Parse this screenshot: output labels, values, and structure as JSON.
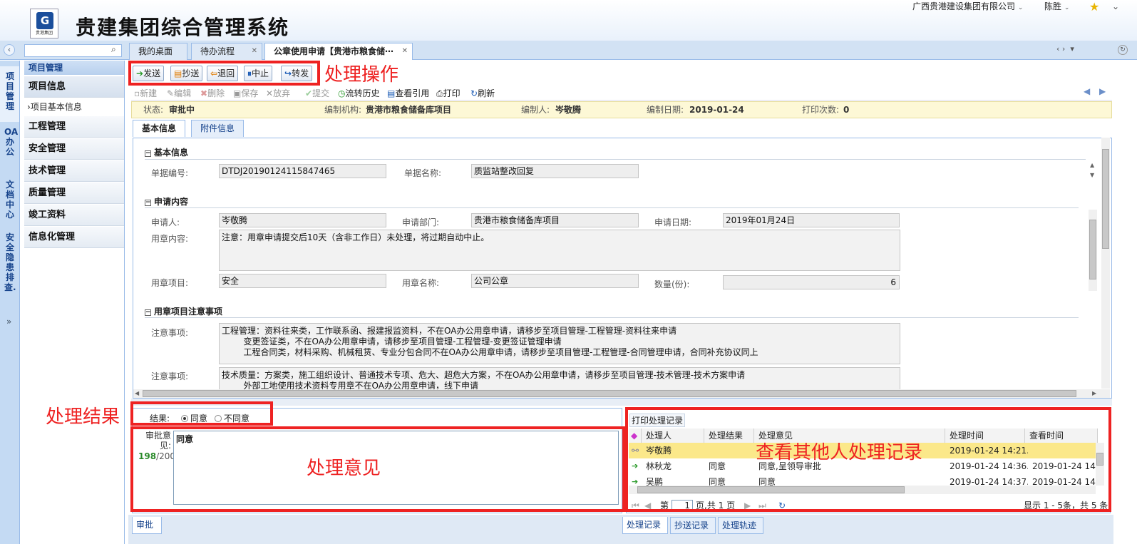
{
  "header": {
    "system_title": "贵建集团综合管理系统",
    "logo_text": "贵港集团",
    "company": "广西贵港建设集团有限公司",
    "user": "陈胜"
  },
  "search": {
    "placeholder": ""
  },
  "tabs": [
    {
      "label": "我的桌面"
    },
    {
      "label": "待办流程"
    },
    {
      "label": "公章使用申请【贵港市粮食储⋯"
    }
  ],
  "vertical_nav": [
    "项目管理",
    "OA办公",
    "文档中心",
    "安全隐患排查..."
  ],
  "sidebar": {
    "header": "项目管理",
    "items": [
      "项目信息",
      "工程管理",
      "安全管理",
      "技术管理",
      "质量管理",
      "竣工资料",
      "信息化管理"
    ],
    "sub_item": "项目基本信息"
  },
  "actions": {
    "send": "发送",
    "cc": "抄送",
    "return": "退回",
    "stop": "中止",
    "forward": "转发"
  },
  "toolbar": {
    "new": "新建",
    "edit": "编辑",
    "delete": "删除",
    "save": "保存",
    "discard": "放弃",
    "submit": "提交",
    "history": "流转历史",
    "view_ref": "查看引用",
    "print": "打印",
    "refresh": "刷新"
  },
  "status": {
    "state_label": "状态:",
    "state_value": "审批中",
    "org_label": "编制机构:",
    "org_value": "贵港市粮食储备库项目",
    "author_label": "编制人:",
    "author_value": "岑敬腾",
    "date_label": "编制日期:",
    "date_value": "2019-01-24",
    "print_label": "打印次数:",
    "print_value": "0"
  },
  "form_tabs": [
    "基本信息",
    "附件信息"
  ],
  "form": {
    "sec_basic": "基本信息",
    "doc_no_label": "单据编号:",
    "doc_no": "DTDJ20190124115847465",
    "doc_name_label": "单据名称:",
    "doc_name": "质监站整改回复",
    "sec_apply": "申请内容",
    "applicant_label": "申请人:",
    "applicant": "岑敬腾",
    "dept_label": "申请部门:",
    "dept": "贵港市粮食储备库项目",
    "apply_date_label": "申请日期:",
    "apply_date": "2019年01月24日",
    "content_label": "用章内容:",
    "content": "注意：用章申请提交后10天（含非工作日）未处理，将过期自动中止。",
    "seal_item_label": "用章项目:",
    "seal_item": "安全",
    "seal_name_label": "用章名称:",
    "seal_name": "公司公章",
    "qty_label": "数量(份):",
    "qty": "6",
    "sec_notes": "用章项目注意事项",
    "note1_label": "注意事项:",
    "note1": "工程管理：资料往来类，工作联系函、报建报监资料，不在OA办公用章申请，请移步至项目管理-工程管理-资料往来申请\n        变更签证类，不在OA办公用章申请，请移步至项目管理-工程管理-变更签证管理申请\n        工程合同类，材料采购、机械租赁、专业分包合同不在OA办公用章申请，请移步至项目管理-工程管理-合同管理申请，合同补充协议同上",
    "note2_label": "注意事项:",
    "note2": "技术质量：方案类，施工组织设计、普通技术专项、危大、超危大方案，不在OA办公用章申请，请移步至项目管理-技术管理-技术方案申请\n        外部工地使用技术资料专用章不在OA办公用章申请，线下申请"
  },
  "result": {
    "label": "结果:",
    "agree": "同意",
    "disagree": "不同意",
    "selected": "同意",
    "opinion_label": "审批意见:",
    "count": "198",
    "max": "/200",
    "opinion": "同意"
  },
  "records": {
    "print_btn": "打印处理记录",
    "columns": [
      "处理人",
      "处理结果",
      "处理意见",
      "处理时间",
      "查看时间"
    ],
    "rows": [
      {
        "person": "岑敬腾",
        "result": "",
        "opinion": "",
        "time": "2019-01-24 14:21...",
        "view": ""
      },
      {
        "person": "林秋龙",
        "result": "同意",
        "opinion": "同意,呈领导审批",
        "time": "2019-01-24 14:36...",
        "view": "2019-01-24 14:3..."
      },
      {
        "person": "吴鹏",
        "result": "同意",
        "opinion": "同意",
        "time": "2019-01-24 14:37...",
        "view": "2019-01-24 14:3..."
      }
    ],
    "pager_prefix": "第",
    "page": "1",
    "pager_suffix": "页,共 1 页",
    "display": "显示 1 - 5条，共 5 条"
  },
  "bottom_tabs": {
    "approve": "审批",
    "records": "处理记录",
    "cc_records": "抄送记录",
    "track": "处理轨迹"
  },
  "annotations": {
    "ops": "处理操作",
    "result": "处理结果",
    "opinion": "处理意见",
    "others": "查看其他人处理记录"
  },
  "colors": {
    "annotation": "#ee2222",
    "accent": "#15428b",
    "status_bg": "#fdf8d6",
    "selected_row": "#fbe88a"
  }
}
